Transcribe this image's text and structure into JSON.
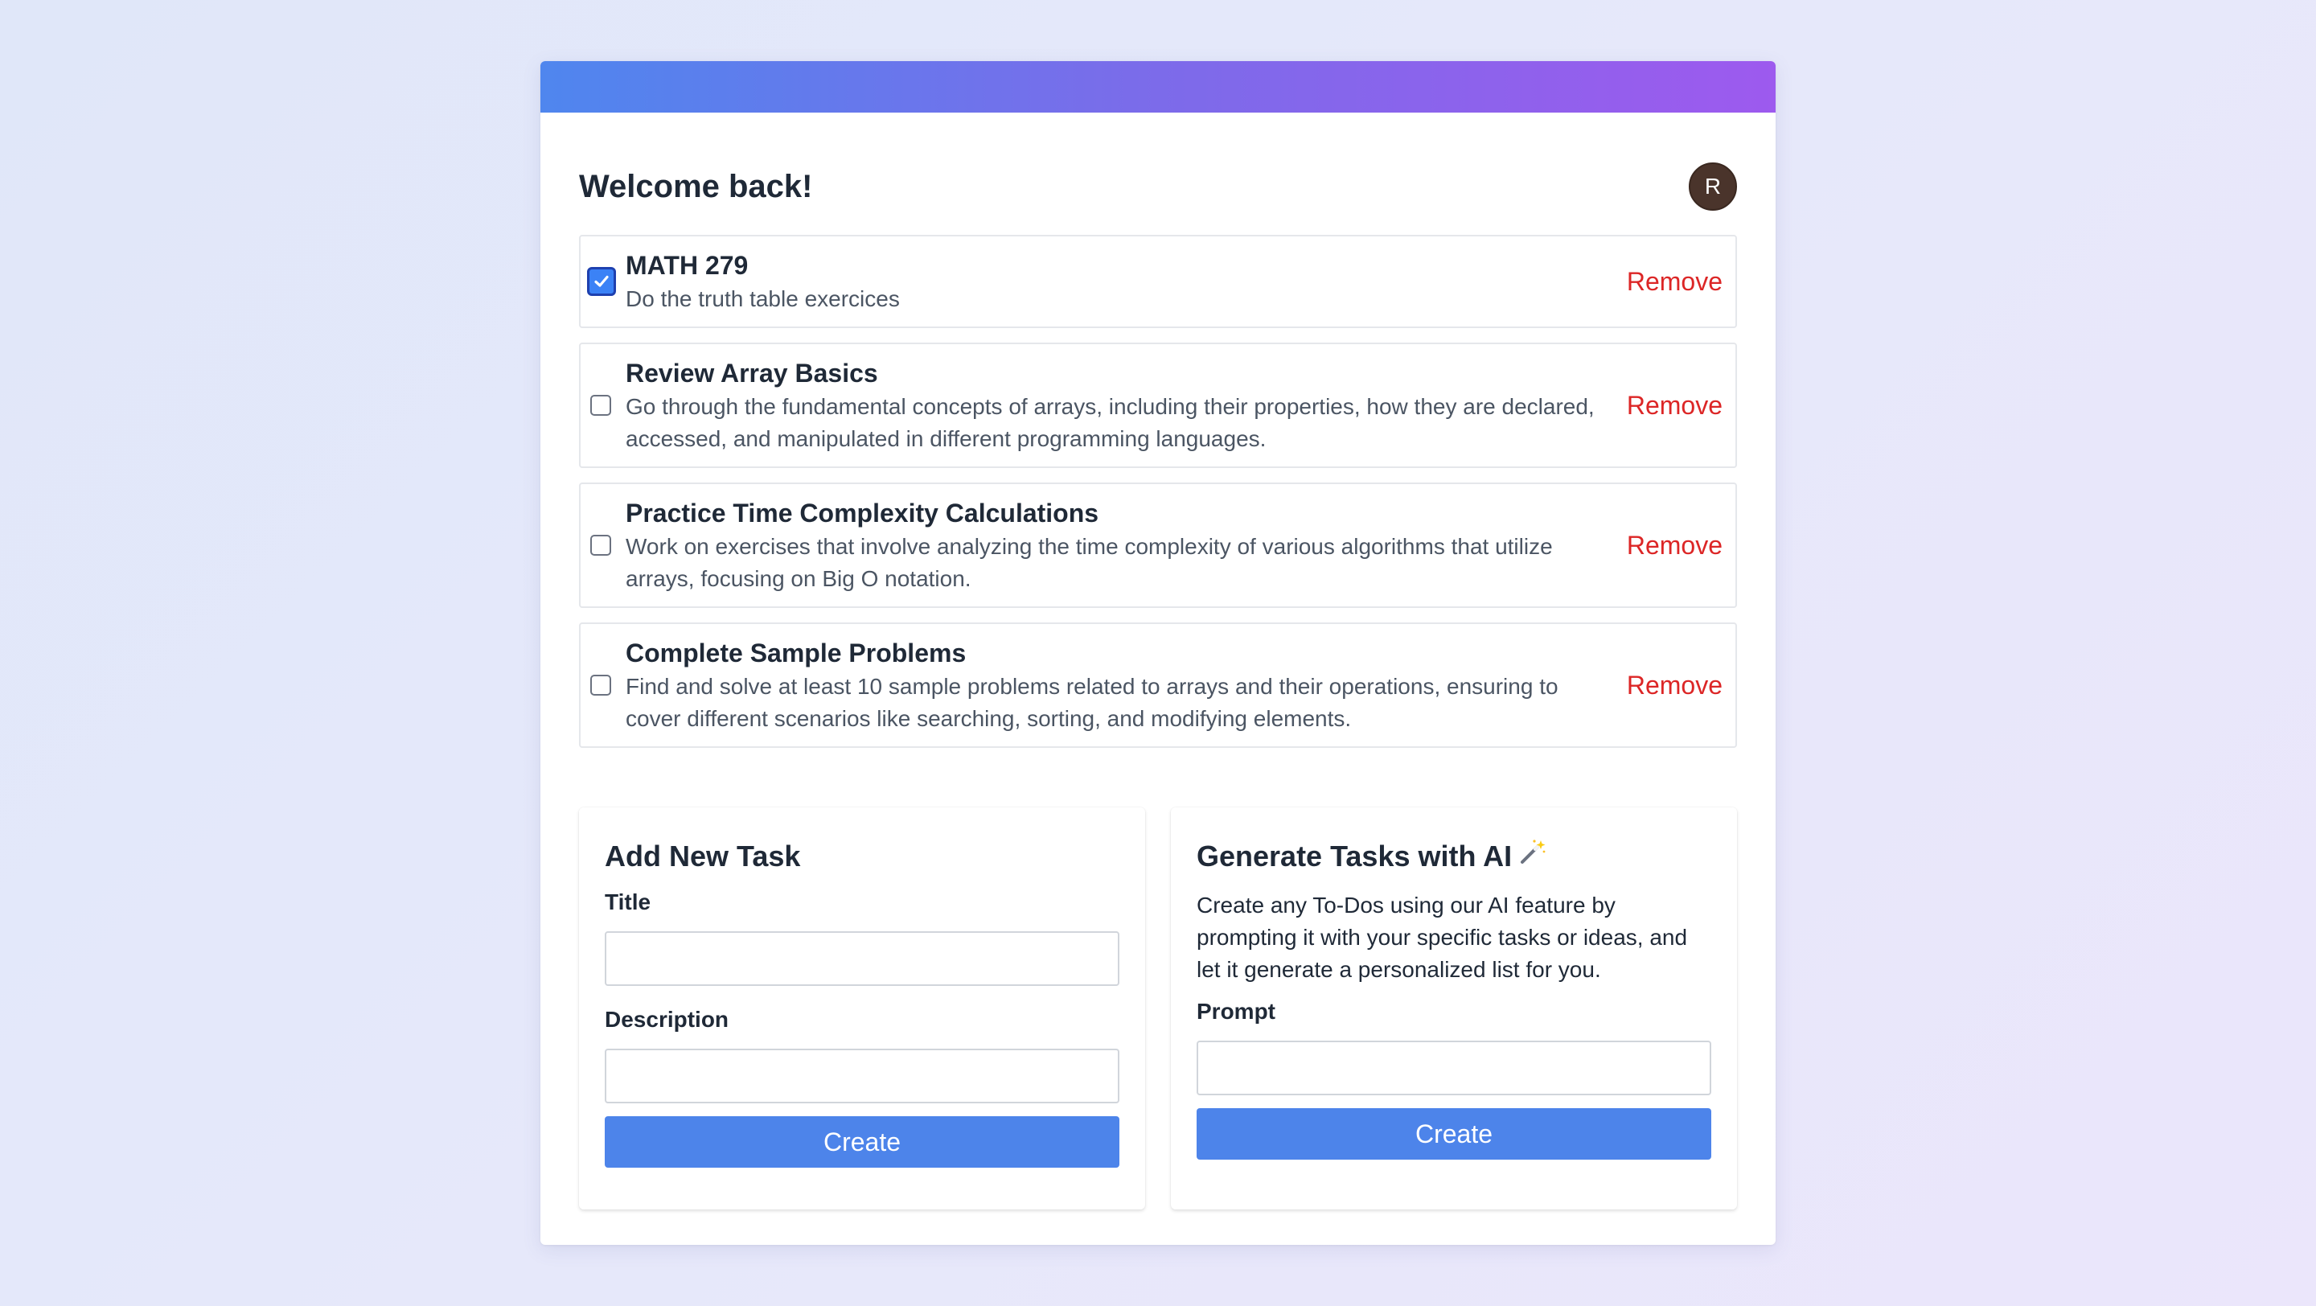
{
  "header": {
    "welcome": "Welcome back!",
    "avatar_initial": "R"
  },
  "tasks": [
    {
      "title": "MATH 279",
      "description": "Do the truth table exercices",
      "checked": true,
      "remove_label": "Remove"
    },
    {
      "title": "Review Array Basics",
      "description": "Go through the fundamental concepts of arrays, including their properties, how they are declared, accessed, and manipulated in different programming languages.",
      "checked": false,
      "remove_label": "Remove"
    },
    {
      "title": "Practice Time Complexity Calculations",
      "description": "Work on exercises that involve analyzing the time complexity of various algorithms that utilize arrays, focusing on Big O notation.",
      "checked": false,
      "remove_label": "Remove"
    },
    {
      "title": "Complete Sample Problems",
      "description": "Find and solve at least 10 sample problems related to arrays and their operations, ensuring to cover different scenarios like searching, sorting, and modifying elements.",
      "checked": false,
      "remove_label": "Remove"
    }
  ],
  "add_task": {
    "title": "Add New Task",
    "title_label": "Title",
    "title_value": "",
    "description_label": "Description",
    "description_value": "",
    "create_label": "Create"
  },
  "ai": {
    "title": "Generate Tasks with AI",
    "icon": "magic-wand-icon",
    "description": "Create any To-Dos using our AI feature by prompting it with your specific tasks or ideas, and let it generate a personalized list for you.",
    "prompt_label": "Prompt",
    "prompt_value": "",
    "create_label": "Create"
  },
  "colors": {
    "accent": "#4d84ea",
    "gradient_start": "#4f86ee",
    "gradient_end": "#9d5aee",
    "danger": "#dc2626",
    "avatar_bg": "#4a342b"
  }
}
